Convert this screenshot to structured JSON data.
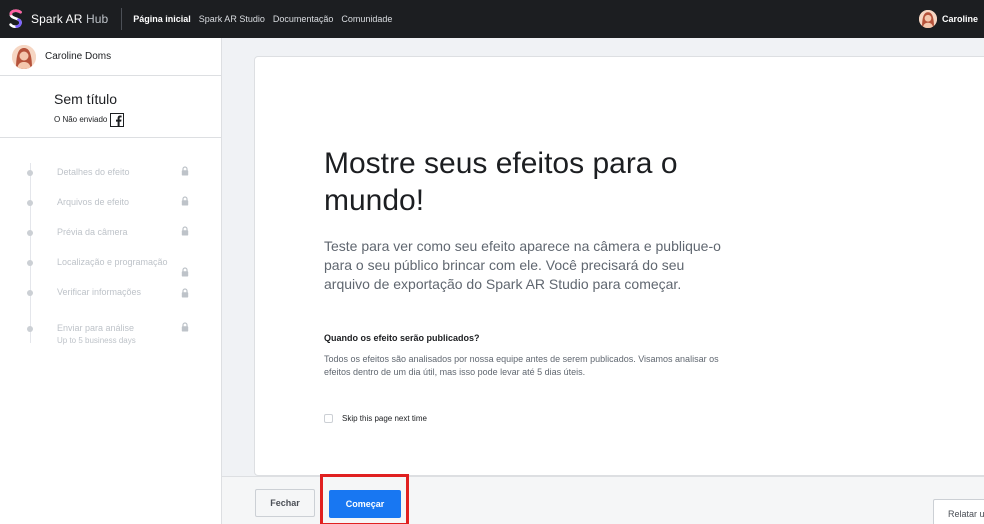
{
  "topbar": {
    "brand_main": "Spark AR",
    "brand_sub": "Hub",
    "nav": [
      {
        "label": "Página inicial",
        "active": true
      },
      {
        "label": "Spark AR Studio",
        "active": false
      },
      {
        "label": "Documentação",
        "active": false
      },
      {
        "label": "Comunidade",
        "active": false
      }
    ],
    "user_name": "Caroline"
  },
  "sidebar": {
    "user_name": "Caroline Doms",
    "project_title": "Sem título",
    "project_status": "O Não enviado",
    "steps": [
      {
        "label": "Detalhes do efeito"
      },
      {
        "label": "Arquivos de efeito"
      },
      {
        "label": "Prévia da câmera"
      },
      {
        "label": "Localização e programação"
      },
      {
        "label": "Verificar informações"
      },
      {
        "label": "Enviar para análise",
        "sub": "Up to 5 business days"
      }
    ]
  },
  "main": {
    "headline": "Mostre seus efeitos para o mundo!",
    "intro": "Teste para ver como seu efeito aparece na câmera e publique-o para o seu público brincar com ele. Você precisará do seu arquivo de exportação do Spark AR Studio para começar.",
    "question_title": "Quando os efeito serão publicados?",
    "question_body": "Todos os efeitos são analisados por nossa equipe antes de serem publicados. Visamos analisar os efeitos dentro de um dia útil, mas isso pode levar até 5 dias úteis.",
    "skip_label": "Skip this page next time"
  },
  "footer": {
    "close_label": "Fechar",
    "start_label": "Começar",
    "report_label": "Relatar um problema"
  },
  "colors": {
    "primary": "#1877f2",
    "topbar": "#1c1e21",
    "highlight": "#e02020"
  }
}
